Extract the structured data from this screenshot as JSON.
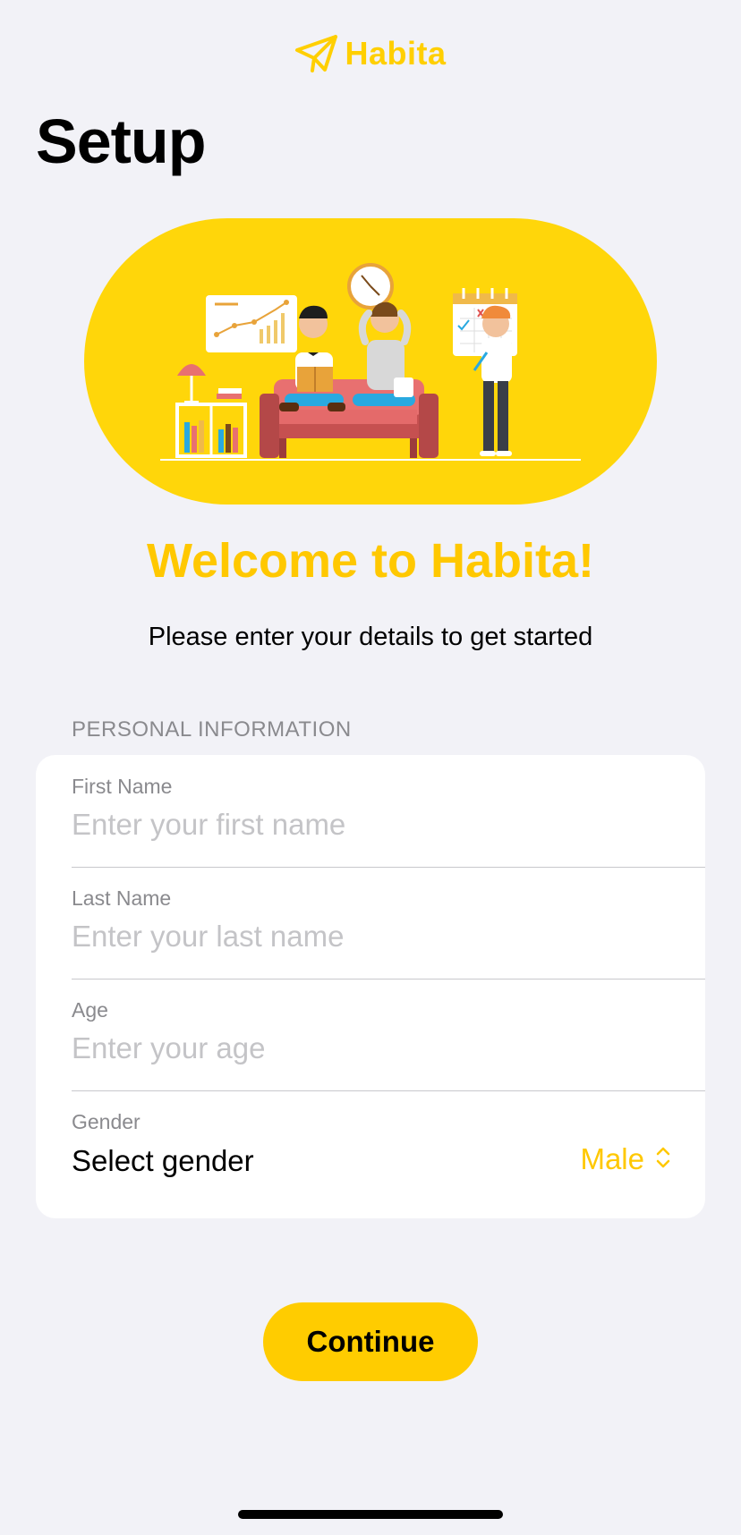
{
  "brand": {
    "name": "Habita",
    "icon": "paper-plane-icon"
  },
  "page": {
    "title": "Setup"
  },
  "hero": {
    "illustration": "family-living-room-illustration"
  },
  "welcome": {
    "heading": "Welcome to Habita!",
    "subtitle": "Please enter your details to get started"
  },
  "form": {
    "section_header": "PERSONAL INFORMATION",
    "first_name": {
      "label": "First Name",
      "placeholder": "Enter your first name",
      "value": ""
    },
    "last_name": {
      "label": "Last Name",
      "placeholder": "Enter your last name",
      "value": ""
    },
    "age": {
      "label": "Age",
      "placeholder": "Enter your age",
      "value": ""
    },
    "gender": {
      "label": "Gender",
      "prompt": "Select gender",
      "selected": "Male",
      "icon": "chevron-up-down-icon"
    }
  },
  "actions": {
    "continue_label": "Continue"
  },
  "colors": {
    "accent": "#ffcc00",
    "background": "#f2f2f7",
    "card": "#ffffff",
    "secondary_text": "#8a8a8e"
  }
}
